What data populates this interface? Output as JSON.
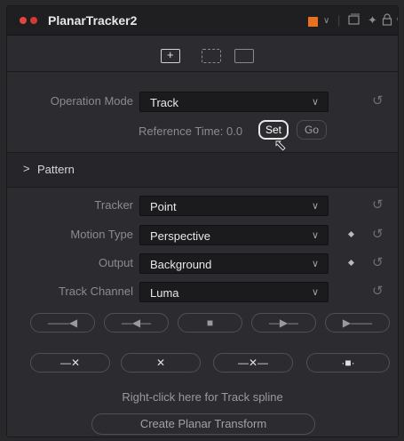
{
  "titlebar": {
    "node_name": "PlanarTracker2",
    "node_color": "#e8701e"
  },
  "tabs": [
    {
      "icon": "tracker-controls-icon",
      "active": true
    },
    {
      "icon": "magic-wand-icon",
      "active": false
    },
    {
      "icon": "settings-icon",
      "active": false
    }
  ],
  "operation_mode": {
    "label": "Operation Mode",
    "value": "Track"
  },
  "reference_time": {
    "label": "Reference Time: 0.0",
    "set_label": "Set",
    "go_label": "Go"
  },
  "pattern": {
    "label": "Pattern"
  },
  "tracker": {
    "label": "Tracker",
    "value": "Point"
  },
  "motion_type": {
    "label": "Motion Type",
    "value": "Perspective"
  },
  "output": {
    "label": "Output",
    "value": "Background"
  },
  "track_channel": {
    "label": "Track Channel",
    "value": "Luma"
  },
  "hint_text": "Right-click here for Track spline",
  "create_planar_transform_label": "Create Planar Transform"
}
